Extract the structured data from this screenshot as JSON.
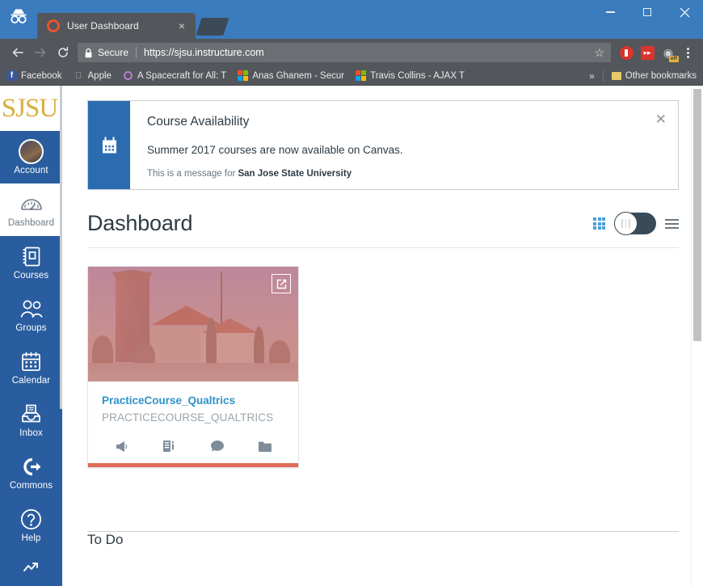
{
  "window": {
    "minimize_label": "Minimize",
    "maximize_label": "Maximize",
    "close_label": "Close"
  },
  "browser": {
    "incognito_icon": "incognito-icon",
    "tab": {
      "title": "User Dashboard",
      "favicon": "canvas-favicon",
      "close_label": "×"
    },
    "new_tab_label": "",
    "nav": {
      "back_label": "←",
      "forward_label": "→",
      "reload_label": "⟳"
    },
    "omnibox": {
      "security_label": "Secure",
      "url": "https://sjsu.instructure.com",
      "bookmark_star": "☆"
    },
    "extensions": [
      {
        "name": "adblock-extension",
        "label": ""
      },
      {
        "name": "fast-forward-extension",
        "label": "▶▶"
      },
      {
        "name": "ghostery-extension",
        "label": "●",
        "badge": "off"
      }
    ],
    "menu_label": "⋮",
    "bookmarks": [
      {
        "name": "bookmark-facebook",
        "label": "Facebook",
        "icon": "facebook-icon"
      },
      {
        "name": "bookmark-apple",
        "label": "Apple",
        "icon": "apple-icon"
      },
      {
        "name": "bookmark-spacecraft",
        "label": "A Spacecraft for All: T",
        "icon": "circle-icon"
      },
      {
        "name": "bookmark-anas-ghanem",
        "label": "Anas Ghanem - Secur",
        "icon": "microsoft-icon"
      },
      {
        "name": "bookmark-travis-collins",
        "label": "Travis Collins - AJAX T",
        "icon": "microsoft-icon"
      }
    ],
    "bookmarks_overflow_label": "»",
    "other_bookmarks_label": "Other bookmarks"
  },
  "canvas": {
    "brand": "SJSU",
    "nav_items": [
      {
        "name": "sidebar-item-account",
        "label": "Account",
        "icon": "avatar-icon",
        "active": false
      },
      {
        "name": "sidebar-item-dashboard",
        "label": "Dashboard",
        "icon": "dashboard-gauge-icon",
        "active": true
      },
      {
        "name": "sidebar-item-courses",
        "label": "Courses",
        "icon": "courses-book-icon",
        "active": false
      },
      {
        "name": "sidebar-item-groups",
        "label": "Groups",
        "icon": "groups-people-icon",
        "active": false
      },
      {
        "name": "sidebar-item-calendar",
        "label": "Calendar",
        "icon": "calendar-icon",
        "active": false
      },
      {
        "name": "sidebar-item-inbox",
        "label": "Inbox",
        "icon": "inbox-tray-icon",
        "active": false
      },
      {
        "name": "sidebar-item-commons",
        "label": "Commons",
        "icon": "commons-arrow-icon",
        "active": false
      },
      {
        "name": "sidebar-item-help",
        "label": "Help",
        "icon": "help-question-icon",
        "active": false
      }
    ],
    "alert": {
      "icon": "calendar-icon",
      "title": "Course Availability",
      "message": "Summer 2017 courses are now available on Canvas.",
      "footer_prefix": "This is a message for ",
      "footer_institution": "San Jose State University",
      "close_label": "✕"
    },
    "dashboard": {
      "title": "Dashboard",
      "view_grid_label": "Card View",
      "view_toggle_label": "Dashboard View Toggle",
      "view_list_label": "List View"
    },
    "courses": [
      {
        "name": "course-card",
        "title": "PracticeCourse_Qualtrics",
        "subtitle": "PRACTICECOURSE_QUALTRICS",
        "edit_label": "Edit course nickname and color",
        "bar_color": "#df6a57",
        "title_color": "#2f92c9",
        "actions": [
          {
            "name": "card-announcements-icon",
            "label": "Announcements"
          },
          {
            "name": "card-assignments-icon",
            "label": "Assignments"
          },
          {
            "name": "card-discussions-icon",
            "label": "Discussions"
          },
          {
            "name": "card-files-icon",
            "label": "Files"
          }
        ]
      }
    ],
    "todo": {
      "title": "To Do"
    }
  },
  "colors": {
    "sidebar_blue": "#2a5d9f",
    "window_blue": "#3b7cbf",
    "chrome_gray": "#53565b",
    "brand_gold": "#d8ae3c",
    "link_blue": "#2f92c9",
    "card_bar": "#df6a57",
    "alert_blue": "#2b6cb0"
  }
}
